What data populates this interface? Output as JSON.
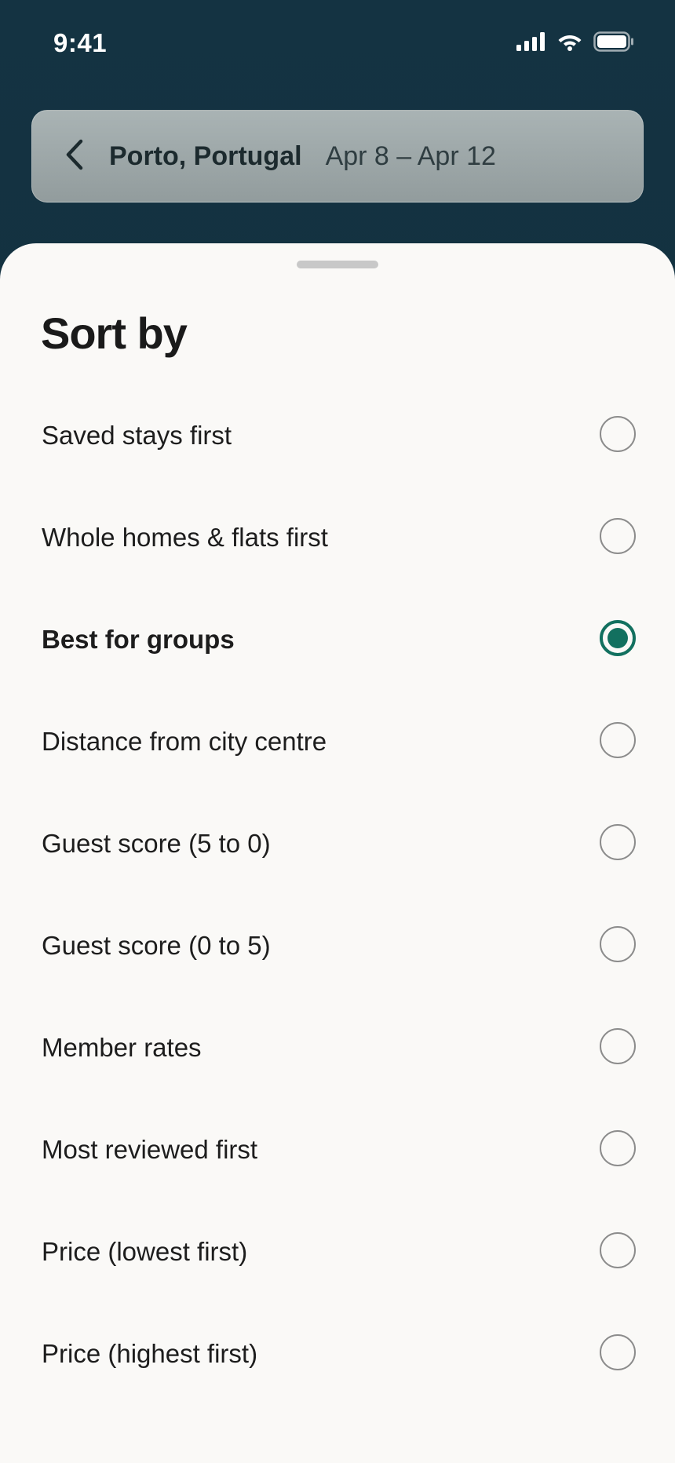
{
  "status_bar": {
    "time": "9:41",
    "icons": [
      "cellular-signal-icon",
      "wifi-icon",
      "battery-icon"
    ]
  },
  "search_header": {
    "back_icon": "chevron-left-icon",
    "location": "Porto, Portugal",
    "dates": "Apr 8 – Apr 12"
  },
  "sheet": {
    "title": "Sort by",
    "options": [
      {
        "label": "Saved stays first",
        "selected": false
      },
      {
        "label": "Whole homes & flats first",
        "selected": false
      },
      {
        "label": "Best for groups",
        "selected": true
      },
      {
        "label": "Distance from city centre",
        "selected": false
      },
      {
        "label": "Guest score (5 to 0)",
        "selected": false
      },
      {
        "label": "Guest score (0 to 5)",
        "selected": false
      },
      {
        "label": "Member rates",
        "selected": false
      },
      {
        "label": "Most reviewed first",
        "selected": false
      },
      {
        "label": "Price (lowest first)",
        "selected": false
      },
      {
        "label": "Price (highest first)",
        "selected": false
      }
    ]
  },
  "colors": {
    "accent": "#12705f",
    "header_background": "#143342",
    "sheet_background": "#faf9f7"
  }
}
